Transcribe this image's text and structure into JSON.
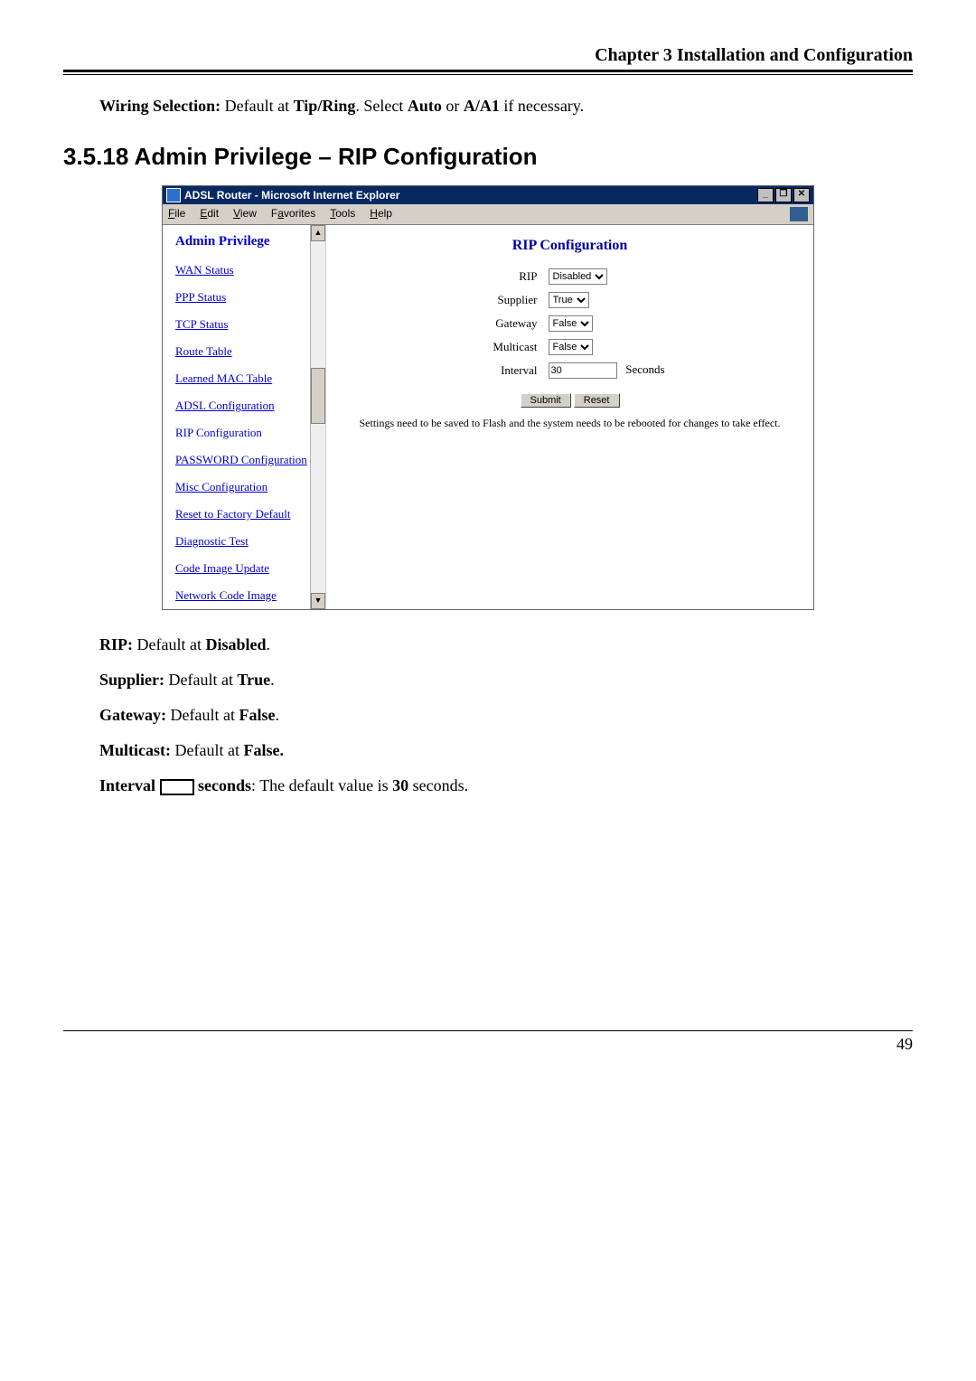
{
  "chapter_title": "Chapter 3 Installation and Configuration",
  "intro_line": {
    "prefix": "Wiring Selection:",
    "mid1": " Default at ",
    "b1": "Tip/Ring",
    "mid2": ". Select ",
    "b2": "Auto",
    "mid3": " or ",
    "b3": "A/A1",
    "suffix": " if necessary."
  },
  "section_heading": "3.5.18 Admin Privilege – RIP Configuration",
  "screenshot": {
    "window_title": "ADSL Router - Microsoft Internet Explorer",
    "win_min": "_",
    "win_max": "❐",
    "win_close": "✕",
    "menu": {
      "file": "File",
      "edit": "Edit",
      "view": "View",
      "favorites": "Favorites",
      "tools": "Tools",
      "help": "Help"
    },
    "sidebar": {
      "heading": "Admin Privilege",
      "items": [
        "WAN Status",
        "PPP Status",
        "TCP Status",
        "Route Table",
        "Learned MAC Table",
        "ADSL Configuration",
        "RIP Configuration",
        "PASSWORD Configuration",
        "Misc Configuration",
        "Reset to Factory Default",
        "Diagnostic Test",
        "Code Image Update",
        "Network Code Image"
      ]
    },
    "content": {
      "title": "RIP Configuration",
      "fields": {
        "rip_label": "RIP",
        "rip_value": "Disabled",
        "supplier_label": "Supplier",
        "supplier_value": "True",
        "gateway_label": "Gateway",
        "gateway_value": "False",
        "multicast_label": "Multicast",
        "multicast_value": "False",
        "interval_label": "Interval",
        "interval_value": "30",
        "interval_unit": "Seconds"
      },
      "submit_label": "Submit",
      "reset_label": "Reset",
      "note": "Settings need to be saved to Flash and the system needs to be rebooted for changes to take effect."
    }
  },
  "definitions": {
    "rip": {
      "label": "RIP:",
      "text": " Default at ",
      "value": "Disabled",
      "suffix": "."
    },
    "supplier": {
      "label": "Supplier:",
      "text": " Default at ",
      "value": "True",
      "suffix": "."
    },
    "gateway": {
      "label": "Gateway:",
      "text": " Default at ",
      "value": "False",
      "suffix": "."
    },
    "multicast": {
      "label": "Multicast:",
      "text": " Default at ",
      "value": "False."
    },
    "interval": {
      "label": "Interval ",
      "tail": " seconds",
      "desc": ": The default value is ",
      "value": "30",
      "suffix": " seconds."
    }
  },
  "page_number": "49"
}
